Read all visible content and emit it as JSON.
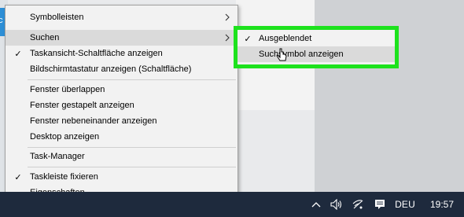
{
  "colors": {
    "taskbar": "#1e2a3d",
    "menu_bg": "#f2f2f2",
    "menu_highlight": "#dadada",
    "annotation_green": "#1de21d"
  },
  "context_menu": {
    "items": [
      {
        "label": "Symbolleisten",
        "checked": false,
        "submenu": true
      },
      {
        "label": "Suchen",
        "checked": false,
        "submenu": true,
        "highlighted": true
      },
      {
        "label": "Taskansicht-Schaltfläche anzeigen",
        "checked": true,
        "submenu": false
      },
      {
        "label": "Bildschirmtastatur anzeigen (Schaltfläche)",
        "checked": false,
        "submenu": false
      },
      {
        "label": "Fenster überlappen",
        "checked": false,
        "submenu": false
      },
      {
        "label": "Fenster gestapelt anzeigen",
        "checked": false,
        "submenu": false
      },
      {
        "label": "Fenster nebeneinander anzeigen",
        "checked": false,
        "submenu": false
      },
      {
        "label": "Desktop anzeigen",
        "checked": false,
        "submenu": false
      },
      {
        "label": "Task-Manager",
        "checked": false,
        "submenu": false
      },
      {
        "label": "Taskleiste fixieren",
        "checked": true,
        "submenu": false
      },
      {
        "label": "Eigenschaften",
        "checked": false,
        "submenu": false
      }
    ]
  },
  "submenu": {
    "items": [
      {
        "label": "Ausgeblendet",
        "checked": true
      },
      {
        "label": "Suchsymbol anzeigen",
        "checked": false,
        "hovered": true
      }
    ]
  },
  "tray": {
    "language": "DEU",
    "time": "19:57",
    "icons": [
      "chevron-up-icon",
      "speaker-icon",
      "network-icon",
      "notification-icon"
    ]
  },
  "background": {
    "corner_glyph": "c"
  }
}
